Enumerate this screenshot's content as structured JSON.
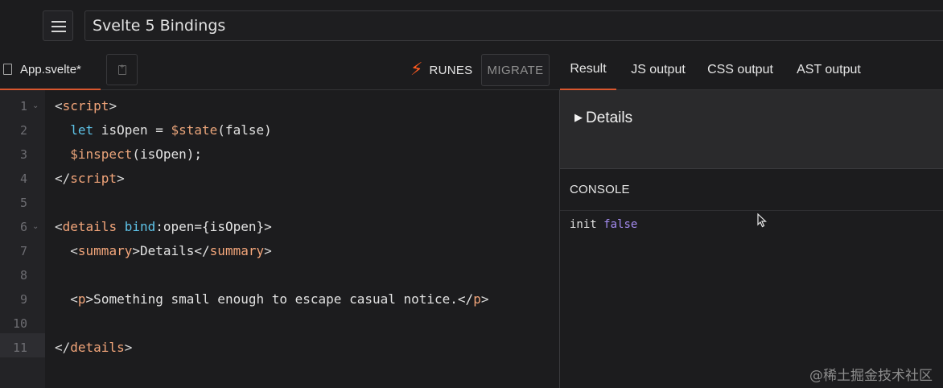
{
  "header": {
    "menu_icon": "hamburger-icon",
    "title_value": "Svelte 5 Bindings"
  },
  "editor": {
    "file_tab": {
      "icon": "file-icon",
      "name": "App.svelte*"
    },
    "new_file_icon": "new-file-icon",
    "runes": {
      "icon": "lightning-bolt-icon",
      "icon_glyph": "⚡",
      "label": "RUNES",
      "accent": "#ff5a1f"
    },
    "migrate_label": "MIGRATE",
    "line_numbers": [
      "1",
      "2",
      "3",
      "4",
      "5",
      "6",
      "7",
      "8",
      "9",
      "10",
      "11"
    ],
    "code": {
      "l1": {
        "open": "<",
        "tag": "script",
        "close": ">"
      },
      "l2": {
        "kw": "let",
        "rest1": " isOpen = ",
        "rune": "$state",
        "rest2": "(false)"
      },
      "l3": {
        "rune": "$inspect",
        "rest": "(isOpen);"
      },
      "l4": {
        "open": "</",
        "tag": "script",
        "close": ">"
      },
      "l6": {
        "open": "<",
        "tag": "details",
        "sp": " ",
        "kw": "bind",
        "rest": ":open={isOpen}>"
      },
      "l7": {
        "open": "<",
        "tag": "summary",
        "mid": ">Details</",
        "tag2": "summary",
        "close": ">"
      },
      "l9": {
        "open": "<",
        "tag": "p",
        "mid": ">Something small enough to escape casual notice.</",
        "tag2": "p",
        "close": ">"
      },
      "l11": {
        "open": "</",
        "tag": "details",
        "close": ">"
      }
    }
  },
  "output": {
    "tabs": [
      "Result",
      "JS output",
      "CSS output",
      "AST output"
    ],
    "active_tab": "Result",
    "preview": {
      "summary_glyph": "▶",
      "summary_text": "Details"
    },
    "console": {
      "header": "CONSOLE",
      "entry_label": "init",
      "entry_value": "false"
    }
  },
  "watermark": "@稀土掘金技术社区",
  "colors": {
    "accent": "#d9562e",
    "tag": "#f2a57a",
    "keyword": "#5ec3e8",
    "console_value": "#a48bf0"
  }
}
